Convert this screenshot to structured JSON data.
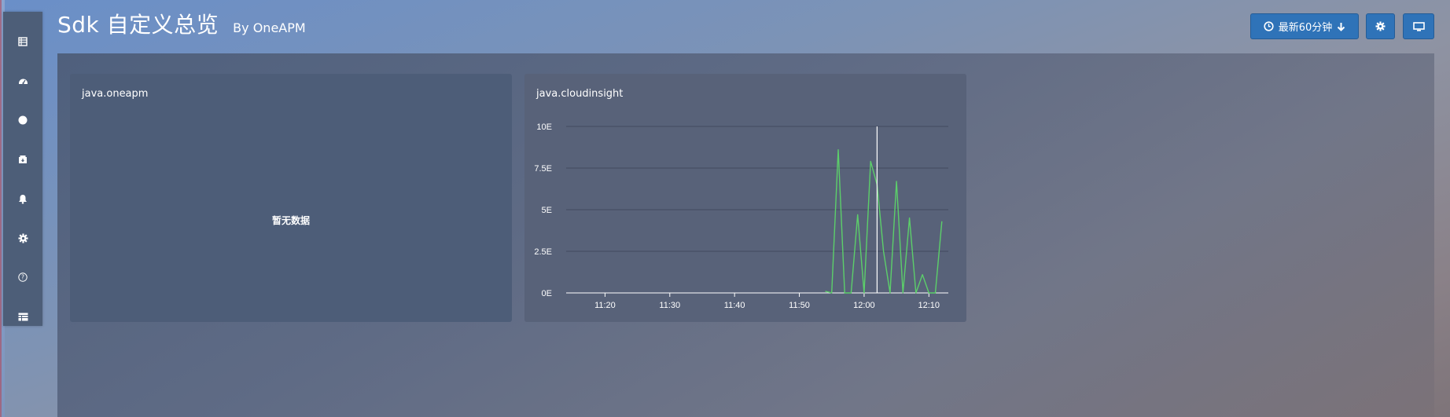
{
  "header": {
    "title": "Sdk 自定义总览",
    "subtitle": "By  OneAPM"
  },
  "toolbar": {
    "time_range_label": "最新60分钟",
    "time_icon": "clock-icon",
    "dropdown_icon": "arrow-down-icon",
    "settings_icon": "gear-icon",
    "monitor_icon": "monitor-icon"
  },
  "sidebar": {
    "items": [
      {
        "icon": "list-icon"
      },
      {
        "icon": "dashboard-gauge-icon"
      },
      {
        "icon": "circle-icon"
      },
      {
        "icon": "archive-box-icon"
      },
      {
        "icon": "bell-icon"
      },
      {
        "icon": "gear-icon"
      },
      {
        "icon": "help-icon"
      },
      {
        "icon": "table-icon"
      }
    ]
  },
  "panels": [
    {
      "title": "java.oneapm",
      "empty_text": "暂无数据"
    },
    {
      "title": "java.cloudinsight"
    }
  ],
  "chart_data": {
    "type": "line",
    "title": "java.cloudinsight",
    "xlabel": "",
    "ylabel": "",
    "x_ticks": [
      "11:20",
      "11:30",
      "11:40",
      "11:50",
      "12:00",
      "12:10"
    ],
    "y_ticks": [
      "0E",
      "2.5E",
      "5E",
      "7.5E",
      "10E"
    ],
    "ylim": [
      0,
      10
    ],
    "grid": true,
    "line_color": "#5ccf6a",
    "cursor_at": "12:02",
    "series": [
      {
        "x": [
          "11:54",
          "11:55",
          "11:56",
          "11:57",
          "11:58",
          "11:59",
          "12:00",
          "12:01",
          "12:02",
          "12:03",
          "12:04",
          "12:05",
          "12:06",
          "12:07",
          "12:08",
          "12:09",
          "12:10",
          "12:11",
          "12:12"
        ],
        "values": [
          0.1,
          0,
          8.6,
          0,
          0,
          4.7,
          0,
          7.9,
          6.5,
          2.5,
          0,
          6.7,
          0,
          4.5,
          0,
          1.1,
          0,
          0,
          4.3
        ]
      }
    ]
  },
  "colors": {
    "button_bg": "#2f73b8",
    "sidebar_bg": "#4d5e78",
    "line": "#5ccf6a"
  }
}
